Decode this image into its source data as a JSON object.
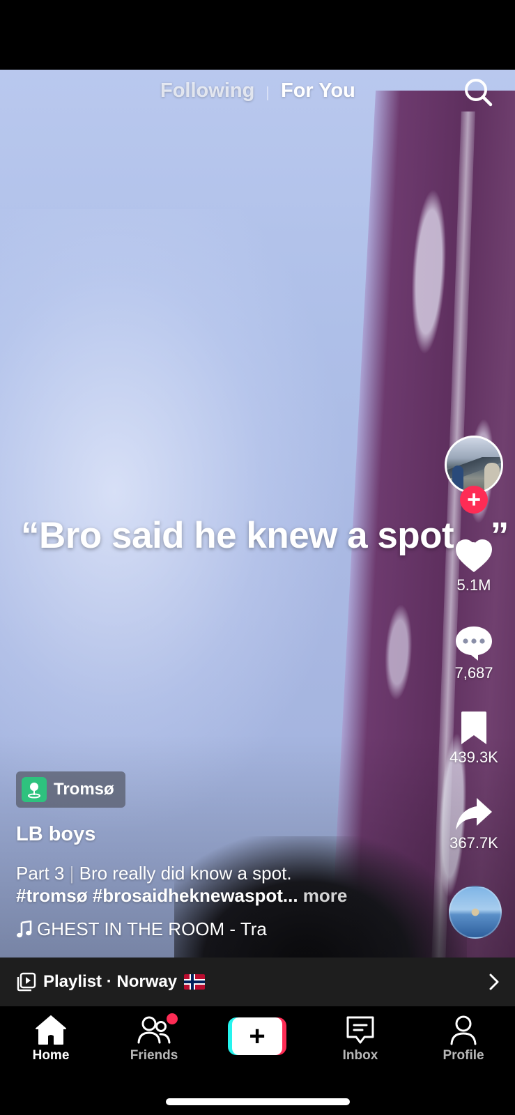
{
  "feed_tabs": {
    "following": "Following",
    "for_you": "For You",
    "active": "For You"
  },
  "video": {
    "overlay_caption": "“Bro said he knew a spot…”"
  },
  "actions": {
    "likes": "5.1M",
    "comments": "7,687",
    "saves": "439.3K",
    "shares": "367.7K"
  },
  "post": {
    "location": "Tromsø",
    "username": "LB boys",
    "part": "Part 3",
    "separator": "|",
    "description": "Bro really did know a spot.",
    "hashtags": "#tromsø #brosaidheknewaspot...",
    "more_label": "more",
    "music": "GHEST IN THE ROOM - Tra"
  },
  "playlist": {
    "label": "Playlist · Norway",
    "flag_icon": "norway-flag-icon"
  },
  "tabbar": {
    "home": "Home",
    "friends": "Friends",
    "inbox": "Inbox",
    "profile": "Profile",
    "active": "Home"
  },
  "colors": {
    "accent_red": "#fe2c55",
    "accent_cyan": "#25f4ee",
    "location_green": "#2ec27e",
    "playlist_bar": "#1e1e1e"
  },
  "icons": [
    "search-icon",
    "heart-icon",
    "comment-icon",
    "bookmark-icon",
    "share-icon",
    "music-note-icon",
    "playlist-icon",
    "chevron-right-icon",
    "home-icon",
    "friends-icon",
    "plus-icon",
    "inbox-icon",
    "profile-icon",
    "location-pin-icon"
  ]
}
